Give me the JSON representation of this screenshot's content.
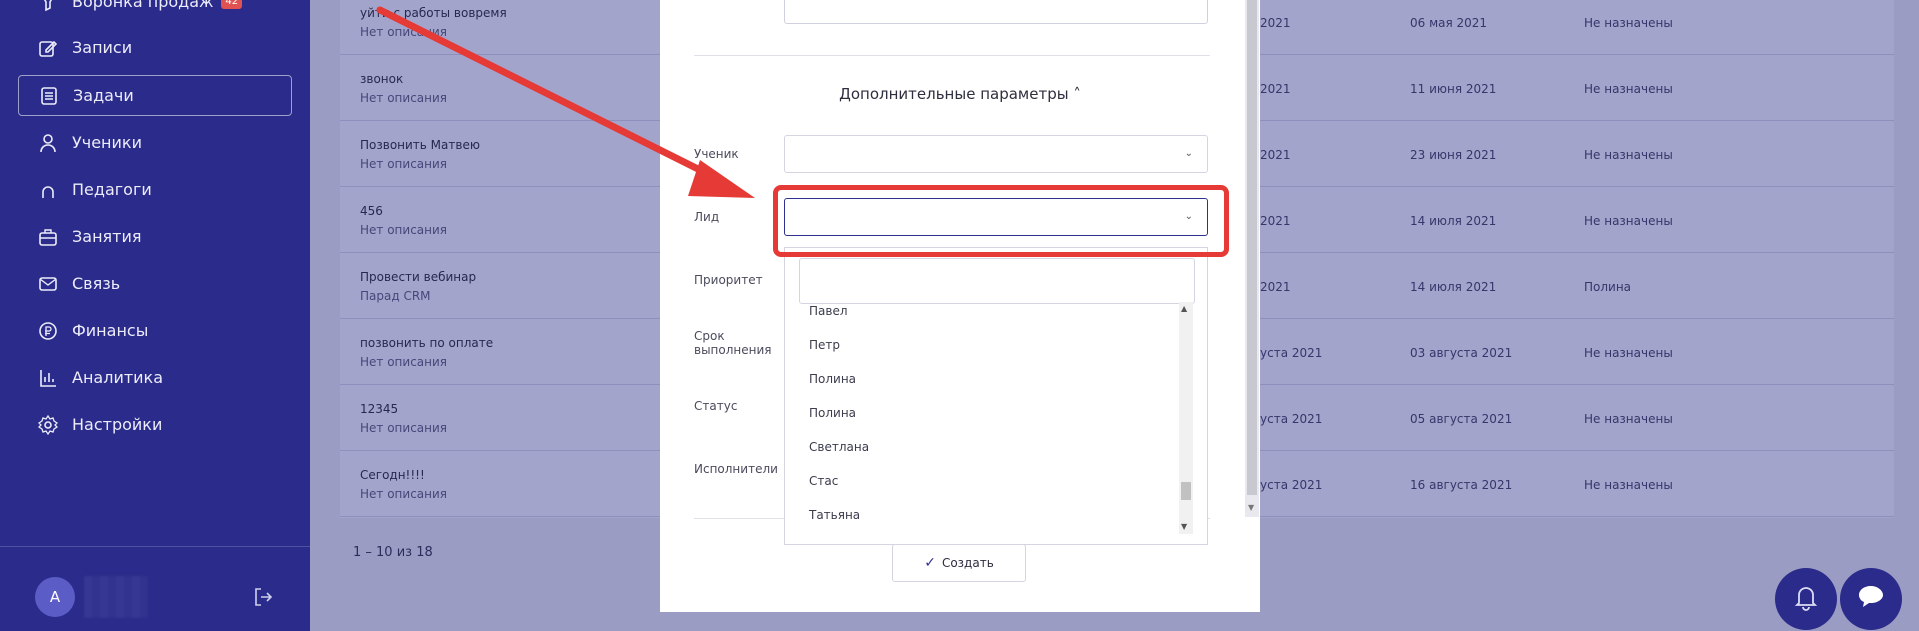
{
  "sidebar": {
    "items": [
      {
        "label": "Воронка продаж",
        "badge": "42",
        "icon": "funnel-icon"
      },
      {
        "label": "Записи",
        "icon": "edit-icon"
      },
      {
        "label": "Задачи",
        "icon": "tasks-icon"
      },
      {
        "label": "Ученики",
        "icon": "user-icon"
      },
      {
        "label": "Педагоги",
        "icon": "teacher-icon"
      },
      {
        "label": "Занятия",
        "icon": "briefcase-icon"
      },
      {
        "label": "Связь",
        "icon": "mail-icon"
      },
      {
        "label": "Финансы",
        "icon": "ruble-icon"
      },
      {
        "label": "Аналитика",
        "icon": "chart-icon"
      },
      {
        "label": "Настройки",
        "icon": "gear-icon"
      }
    ],
    "avatar_initial": "А"
  },
  "table": {
    "rows": [
      {
        "title": "уйти с работы вовремя",
        "desc": "Нет описания",
        "created": "2021",
        "due": "06 мая 2021",
        "assignee": "Не назначены"
      },
      {
        "title": "звонок",
        "desc": "Нет описания",
        "created": "2021",
        "due": "11 июня 2021",
        "assignee": "Не назначены"
      },
      {
        "title": "Позвонить Матвею",
        "desc": "Нет описания",
        "created": "2021",
        "due": "23 июня 2021",
        "assignee": "Не назначены"
      },
      {
        "title": "456",
        "desc": "Нет описания",
        "created": "2021",
        "due": "14 июля 2021",
        "assignee": "Не назначены"
      },
      {
        "title": "Провести вебинар",
        "desc": "Парад CRM",
        "created": "2021",
        "due": "14 июля 2021",
        "assignee": "Полина"
      },
      {
        "title": "позвонить по оплате",
        "desc": "Нет описания",
        "created": "уста 2021",
        "due": "03 августа 2021",
        "assignee": "Не назначены"
      },
      {
        "title": "12345",
        "desc": "Нет описания",
        "created": "уста 2021",
        "due": "05 августа 2021",
        "assignee": "Не назначены"
      },
      {
        "title": "Сегодн!!!!",
        "desc": "Нет описания",
        "created": "уста 2021",
        "due": "16 августа 2021",
        "assignee": "Не назначены"
      }
    ],
    "pagination": "1 – 10 из 18"
  },
  "modal": {
    "advanced_toggle": "Дополнительные параметры ˄",
    "fields": {
      "student": "Ученик",
      "lead": "Лид",
      "priority": "Приоритет",
      "deadline": "Срок выполнения",
      "status": "Статус",
      "executors": "Исполнители"
    },
    "dropdown_options": [
      "Павел",
      "Петр",
      "Полина",
      "Полина",
      "Светлана",
      "Стас",
      "Татьяна"
    ],
    "create_label": "Создать"
  },
  "colors": {
    "sidebar_bg": "#2a2b8a",
    "highlight": "#e53a35"
  }
}
